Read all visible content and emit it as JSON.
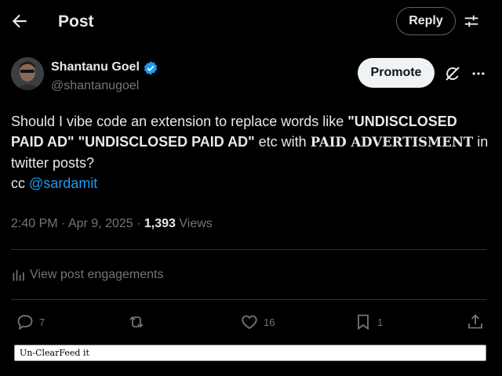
{
  "header": {
    "back_icon": "arrow-left-icon",
    "title": "Post",
    "reply_label": "Reply",
    "settings_icon": "sliders-icon"
  },
  "author": {
    "name": "Shantanu Goel",
    "handle": "@shantanugoel",
    "verified_icon": "verified-badge-icon",
    "verified_color": "#1d9bf0",
    "promote_label": "Promote",
    "grok_icon": "grok-icon",
    "more_icon": "more-dots-icon"
  },
  "post": {
    "part1": "Should I vibe code an extension to replace words like ",
    "quote1": "\"UNDISCLOSED PAID AD\"",
    "space1": " ",
    "quote2": "\"UNDISCLOSED PAID AD\"",
    "part2": " etc with ",
    "replacement": "PAID ADVERTISMENT",
    "part3": " in twitter posts?",
    "cc": "cc ",
    "mention": "@sardamit"
  },
  "meta": {
    "time": "2:40 PM",
    "sep1": " · ",
    "date": "Apr 9, 2025",
    "sep2": " · ",
    "views": "1,393",
    "views_label": " Views"
  },
  "engagements": {
    "icon": "bar-chart-icon",
    "label": "View post engagements"
  },
  "actions": {
    "reply_count": "7",
    "repost_count": "",
    "like_count": "16",
    "bookmark_count": "1"
  },
  "extension": {
    "button_label": "Un-ClearFeed it"
  },
  "colors": {
    "background": "#000000",
    "text": "#e7e9ea",
    "muted": "#71767b",
    "link": "#1d9bf0",
    "divider": "#2f3336"
  }
}
